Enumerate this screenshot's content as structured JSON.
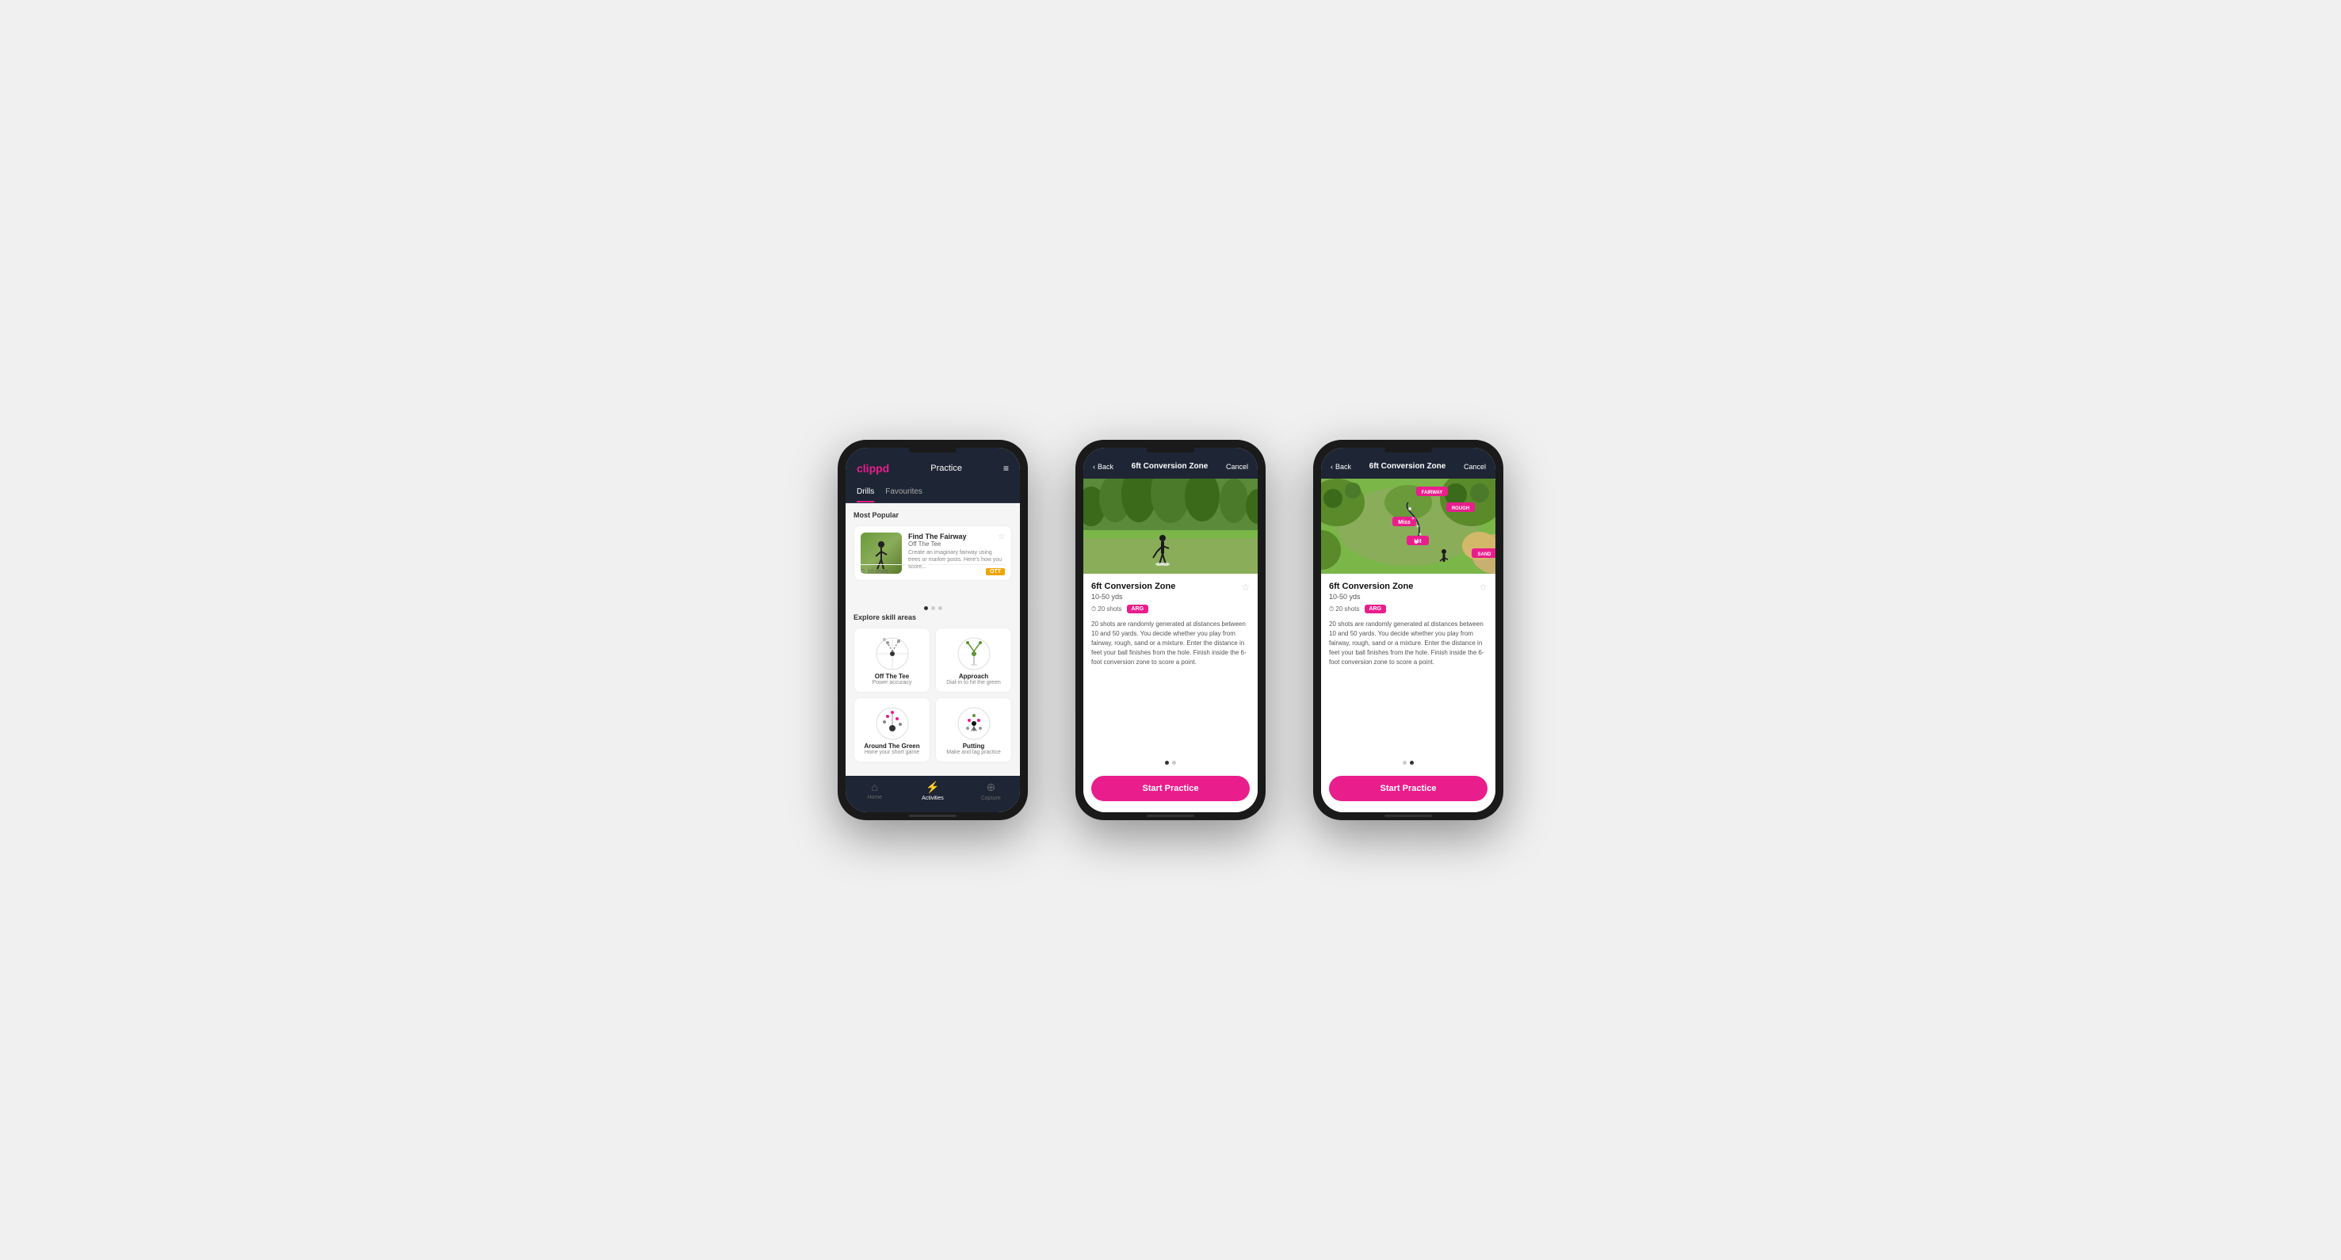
{
  "phone1": {
    "logo": "clippd",
    "header_title": "Practice",
    "tabs": [
      "Drills",
      "Favourites"
    ],
    "active_tab": "Drills",
    "most_popular_label": "Most Popular",
    "drill_card": {
      "title": "Find The Fairway",
      "subtitle": "Off The Tee",
      "description": "Create an imaginary fairway using trees or marker posts. Here's how you score...",
      "shots": "10 shots",
      "badge": "OTT"
    },
    "explore_label": "Explore skill areas",
    "skills": [
      {
        "name": "Off The Tee",
        "desc": "Power accuracy",
        "icon": "ott"
      },
      {
        "name": "Approach",
        "desc": "Dial-in to hit the green",
        "icon": "approach"
      },
      {
        "name": "Around The Green",
        "desc": "Hone your short game",
        "icon": "atg"
      },
      {
        "name": "Putting",
        "desc": "Make and lag practice",
        "icon": "putting"
      }
    ],
    "nav": [
      {
        "label": "Home",
        "icon": "house",
        "active": false
      },
      {
        "label": "Activities",
        "icon": "activities",
        "active": true
      },
      {
        "label": "Capture",
        "icon": "plus-circle",
        "active": false
      }
    ]
  },
  "phone2": {
    "back_label": "Back",
    "header_title": "6ft Conversion Zone",
    "cancel_label": "Cancel",
    "drill_title": "6ft Conversion Zone",
    "range": "10-50 yds",
    "shots": "20 shots",
    "badge": "ARG",
    "description": "20 shots are randomly generated at distances between 10 and 50 yards. You decide whether you play from fairway, rough, sand or a mixture. Enter the distance in feet your ball finishes from the hole. Finish inside the 6-foot conversion zone to score a point.",
    "start_label": "Start Practice",
    "dots": [
      true,
      false
    ]
  },
  "phone3": {
    "back_label": "Back",
    "header_title": "6ft Conversion Zone",
    "cancel_label": "Cancel",
    "drill_title": "6ft Conversion Zone",
    "range": "10-50 yds",
    "shots": "20 shots",
    "badge": "ARG",
    "description": "20 shots are randomly generated at distances between 10 and 50 yards. You decide whether you play from fairway, rough, sand or a mixture. Enter the distance in feet your ball finishes from the hole. Finish inside the 6-foot conversion zone to score a point.",
    "start_label": "Start Practice",
    "dots": [
      false,
      true
    ]
  }
}
